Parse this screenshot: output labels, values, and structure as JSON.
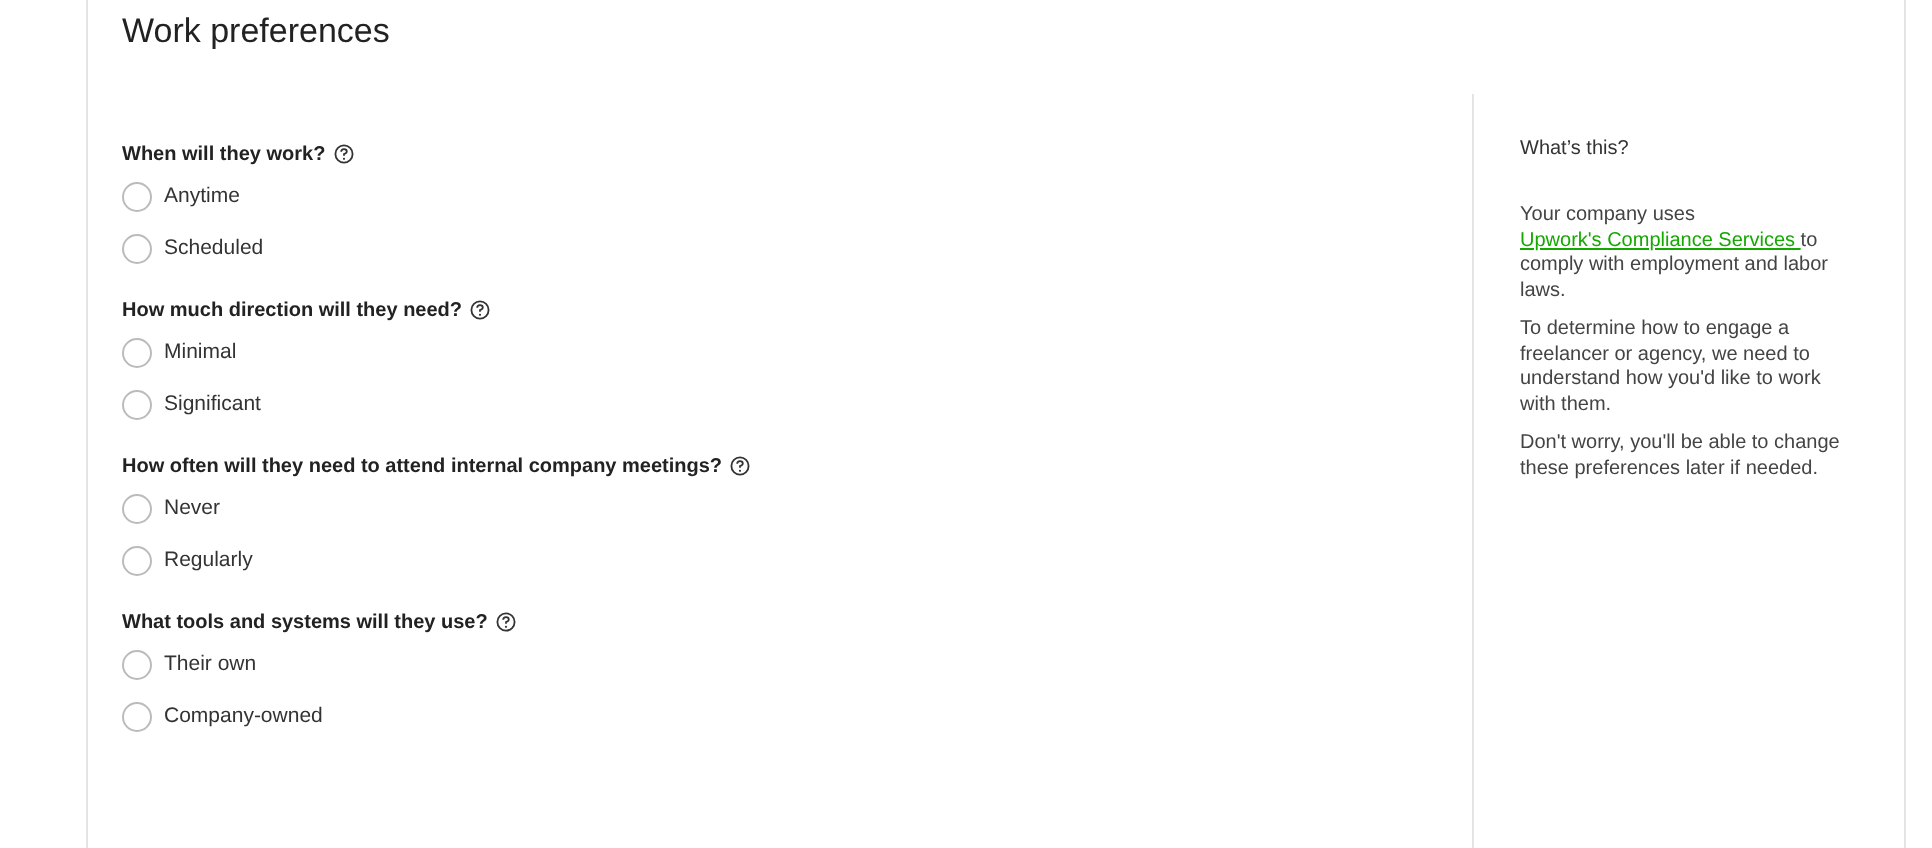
{
  "title": "Work preferences",
  "questions": [
    {
      "label": "When will they work?",
      "options": [
        {
          "label": "Anytime",
          "selected": false
        },
        {
          "label": "Scheduled",
          "selected": false
        }
      ]
    },
    {
      "label": "How much direction will they need?",
      "options": [
        {
          "label": "Minimal",
          "selected": false
        },
        {
          "label": "Significant",
          "selected": false
        }
      ]
    },
    {
      "label": "How often will they need to attend internal company meetings?",
      "options": [
        {
          "label": "Never",
          "selected": false
        },
        {
          "label": "Regularly",
          "selected": false
        }
      ]
    },
    {
      "label": "What tools and systems will they use?",
      "options": [
        {
          "label": "Their own",
          "selected": false
        },
        {
          "label": "Company-owned",
          "selected": false
        }
      ]
    }
  ],
  "sidebar": {
    "heading": "What’s this?",
    "intro": {
      "before": "Your company uses ",
      "link": "Upwork's Compliance Services ",
      "after": "to comply with employment and labor laws."
    },
    "paragraphs": [
      "To determine how to engage a freelancer or agency, we need to understand how you'd like to work with them.",
      "Don't worry, you'll be able to change these preferences later if needed."
    ]
  }
}
